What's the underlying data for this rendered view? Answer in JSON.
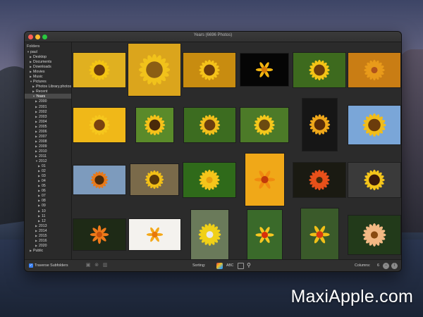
{
  "window": {
    "title": "Years (6696 Photos)"
  },
  "sidebar": {
    "header": "Folders",
    "items": [
      {
        "label": "paul",
        "arrow": "▼",
        "depth": 0
      },
      {
        "label": "Desktop",
        "arrow": "▶",
        "depth": 1
      },
      {
        "label": "Documents",
        "arrow": "▶",
        "depth": 1
      },
      {
        "label": "Downloads",
        "arrow": "▶",
        "depth": 1
      },
      {
        "label": "Movies",
        "arrow": "▶",
        "depth": 1
      },
      {
        "label": "Music",
        "arrow": "▶",
        "depth": 1
      },
      {
        "label": "Pictures",
        "arrow": "▼",
        "depth": 1
      },
      {
        "label": "Photos Library.photoslibrary",
        "arrow": "▶",
        "depth": 2
      },
      {
        "label": "Recent",
        "arrow": "▶",
        "depth": 2
      },
      {
        "label": "Years",
        "arrow": "▼",
        "depth": 2,
        "selected": true
      },
      {
        "label": "2000",
        "arrow": "▶",
        "depth": 3
      },
      {
        "label": "2001",
        "arrow": "▶",
        "depth": 3
      },
      {
        "label": "2002",
        "arrow": "▶",
        "depth": 3
      },
      {
        "label": "2003",
        "arrow": "▶",
        "depth": 3
      },
      {
        "label": "2004",
        "arrow": "▶",
        "depth": 3
      },
      {
        "label": "2005",
        "arrow": "▶",
        "depth": 3
      },
      {
        "label": "2006",
        "arrow": "▶",
        "depth": 3
      },
      {
        "label": "2007",
        "arrow": "▶",
        "depth": 3
      },
      {
        "label": "2008",
        "arrow": "▶",
        "depth": 3
      },
      {
        "label": "2009",
        "arrow": "▶",
        "depth": 3
      },
      {
        "label": "2010",
        "arrow": "▶",
        "depth": 3
      },
      {
        "label": "2011",
        "arrow": "▶",
        "depth": 3
      },
      {
        "label": "2012",
        "arrow": "▼",
        "depth": 3
      },
      {
        "label": "01",
        "arrow": "▶",
        "depth": 4
      },
      {
        "label": "02",
        "arrow": "▶",
        "depth": 4
      },
      {
        "label": "03",
        "arrow": "▶",
        "depth": 4
      },
      {
        "label": "04",
        "arrow": "▶",
        "depth": 4
      },
      {
        "label": "05",
        "arrow": "▶",
        "depth": 4
      },
      {
        "label": "06",
        "arrow": "▶",
        "depth": 4
      },
      {
        "label": "07",
        "arrow": "▶",
        "depth": 4
      },
      {
        "label": "08",
        "arrow": "▶",
        "depth": 4
      },
      {
        "label": "09",
        "arrow": "▶",
        "depth": 4
      },
      {
        "label": "10",
        "arrow": "▶",
        "depth": 4
      },
      {
        "label": "11",
        "arrow": "▶",
        "depth": 4
      },
      {
        "label": "12",
        "arrow": "▶",
        "depth": 4
      },
      {
        "label": "2013",
        "arrow": "▶",
        "depth": 3
      },
      {
        "label": "2014",
        "arrow": "▶",
        "depth": 3
      },
      {
        "label": "2015",
        "arrow": "▶",
        "depth": 3
      },
      {
        "label": "2016",
        "arrow": "▶",
        "depth": 3
      },
      {
        "label": "2020",
        "arrow": "▶",
        "depth": 3
      },
      {
        "label": "Public",
        "arrow": "▶",
        "depth": 1
      }
    ]
  },
  "photos": [
    {
      "w": 1.0,
      "h": 0.66,
      "bg": "#e0b020",
      "petal": "#f4c514",
      "center": "#6b3c0c",
      "type": "sunflower"
    },
    {
      "w": 1.0,
      "h": 1.0,
      "bg": "#dba51c",
      "petal": "#f1c21b",
      "center": "#8b5e14",
      "type": "sunflower"
    },
    {
      "w": 1.0,
      "h": 0.66,
      "bg": "#c88c10",
      "petal": "#f5c21a",
      "center": "#6a3b0b",
      "type": "sunflower"
    },
    {
      "w": 0.92,
      "h": 0.62,
      "bg": "#050505",
      "petal": "#f2b510",
      "center": "#d47a08",
      "type": "tulip"
    },
    {
      "w": 1.0,
      "h": 0.66,
      "bg": "#3d6a1e",
      "petal": "#f4c516",
      "center": "#6b3c0c",
      "type": "sunflower"
    },
    {
      "w": 1.0,
      "h": 0.66,
      "bg": "#c97d14",
      "petal": "#e89a1a",
      "center": "#b0531a",
      "type": "marigold"
    },
    {
      "w": 1.0,
      "h": 0.66,
      "bg": "#f0b818",
      "petal": "#f6c71d",
      "center": "#7a4210",
      "type": "sunflower"
    },
    {
      "w": 0.72,
      "h": 0.66,
      "bg": "#5a8a2a",
      "petal": "#f5c21a",
      "center": "#4a2a0a",
      "type": "sunflower"
    },
    {
      "w": 0.99,
      "h": 0.66,
      "bg": "#3c6c20",
      "petal": "#f2c01b",
      "center": "#6c3e0e",
      "type": "sunflower"
    },
    {
      "w": 0.92,
      "h": 0.66,
      "bg": "#4c7a28",
      "petal": "#f5c81c",
      "center": "#6b4a10",
      "type": "sunflower"
    },
    {
      "w": 0.66,
      "h": 1.0,
      "bg": "#161616",
      "petal": "#f0a81a",
      "center": "#5a2c08",
      "type": "sunflower"
    },
    {
      "w": 1.0,
      "h": 0.74,
      "bg": "#7aa6d8",
      "petal": "#f1bd1a",
      "center": "#6b3c0c",
      "type": "field"
    },
    {
      "w": 1.0,
      "h": 0.56,
      "bg": "#7d9bbd",
      "petal": "#e87a1a",
      "center": "#4a2a0a",
      "type": "sunflower"
    },
    {
      "w": 0.92,
      "h": 0.6,
      "bg": "#7a6a4a",
      "petal": "#f2c017",
      "center": "#5a3a0a",
      "type": "sunflower"
    },
    {
      "w": 1.0,
      "h": 0.66,
      "bg": "#2f6a1a",
      "petal": "#f5c51b",
      "center": "#e8a010",
      "type": "marigold"
    },
    {
      "w": 0.74,
      "h": 1.0,
      "bg": "#f0a818",
      "petal": "#f08a10",
      "center": "#c23a0a",
      "type": "lily"
    },
    {
      "w": 1.0,
      "h": 0.66,
      "bg": "#1a1a12",
      "petal": "#e8501a",
      "center": "#4a2a0a",
      "type": "gerbera"
    },
    {
      "w": 1.0,
      "h": 0.66,
      "bg": "#3a3a3a",
      "petal": "#f4c51b",
      "center": "#3a1a0a",
      "type": "sunflower"
    },
    {
      "w": 1.0,
      "h": 0.6,
      "bg": "#1e2a16",
      "petal": "#f07a1a",
      "center": "#c8500a",
      "type": "rose"
    },
    {
      "w": 0.99,
      "h": 0.6,
      "bg": "#f4f2ee",
      "petal": "#f4a818",
      "center": "#e8780a",
      "type": "tulip"
    },
    {
      "w": 0.72,
      "h": 0.94,
      "bg": "#6a7a5a",
      "petal": "#f0d018",
      "center": "#eaeaea",
      "type": "butterfly"
    },
    {
      "w": 0.66,
      "h": 0.96,
      "bg": "#3a6a2a",
      "petal": "#f8c820",
      "center": "#d8300a",
      "type": "tulip"
    },
    {
      "w": 0.72,
      "h": 1.0,
      "bg": "#3a5a2a",
      "petal": "#f0c018",
      "center": "#d83a10",
      "type": "tulip"
    },
    {
      "w": 1.0,
      "h": 0.74,
      "bg": "#223a1a",
      "petal": "#f2b884",
      "center": "#8a4a10",
      "type": "daisy"
    }
  ],
  "bottombar": {
    "traverse_checked": "✓",
    "traverse_label": "Traverse Subfolders",
    "sorting_label": "Sorting:",
    "sort_abc": "ABC",
    "columns_label": "Columns:",
    "columns_value": "6",
    "minus": "−",
    "plus": "+",
    "info": "i",
    "icons": [
      "folder-icon",
      "close-circle-icon",
      "trash-icon",
      "search-icon"
    ]
  },
  "colors": {
    "window_bg": "#262626",
    "sidebar_bg": "#2a2a2a",
    "grid_bg": "#2b2b2b",
    "selection": "#4a4a4a",
    "accent": "#3b82f6"
  },
  "watermark": "MaxiApple.com"
}
